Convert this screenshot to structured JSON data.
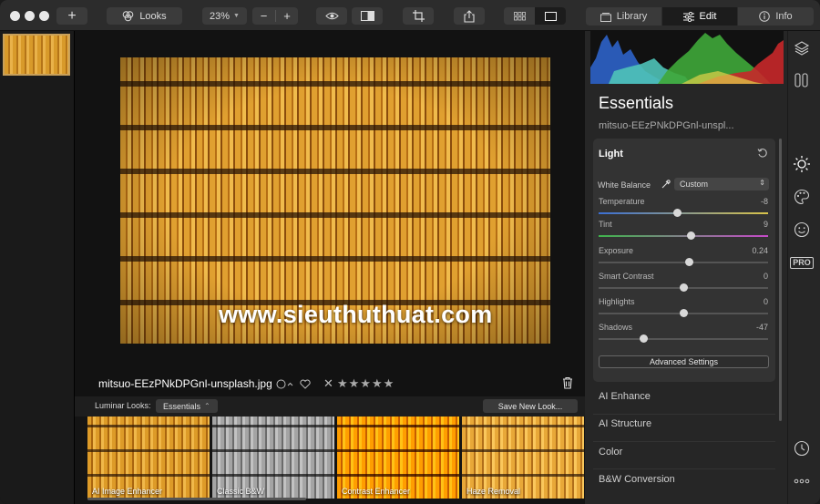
{
  "toolbar": {
    "add_label": "+",
    "looks_label": "Looks",
    "zoom_value": "23%",
    "zoom_out_label": "−",
    "zoom_in_label": "+",
    "tabs": [
      {
        "label": "Library"
      },
      {
        "label": "Edit"
      },
      {
        "label": "Info"
      }
    ]
  },
  "canvas": {
    "watermark": "www.sieuthuthuat.com",
    "file_name": "mitsuo-EEzPNkDPGnl-unsplash.jpg",
    "stars": "★★★★★",
    "reject": "✕"
  },
  "looks_bar": {
    "label": "Luminar Looks:",
    "category": "Essentials",
    "category_arrow": "⌃",
    "save_button": "Save New Look..."
  },
  "looks": [
    {
      "name": "AI Image Enhancer"
    },
    {
      "name": "Classic B&W"
    },
    {
      "name": "Contrast Enhancer"
    },
    {
      "name": "Haze Removal"
    }
  ],
  "panel": {
    "title": "Essentials",
    "file_name": "mitsuo-EEzPNkDPGnl-unspl...",
    "light": {
      "title": "Light",
      "white_balance_label": "White Balance",
      "white_balance_value": "Custom",
      "white_balance_arrow": "⇕",
      "sliders": [
        {
          "label": "Temperature",
          "value": "-8",
          "position": -8,
          "min": -100,
          "max": 100
        },
        {
          "label": "Tint",
          "value": "9",
          "position": 9,
          "min": -100,
          "max": 100
        },
        {
          "label": "Exposure",
          "value": "0.24",
          "position": 0.24,
          "min": -4,
          "max": 4
        },
        {
          "label": "Smart Contrast",
          "value": "0",
          "position": 0,
          "min": -100,
          "max": 100
        },
        {
          "label": "Highlights",
          "value": "0",
          "position": 0,
          "min": -100,
          "max": 100
        },
        {
          "label": "Shadows",
          "value": "-47",
          "position": -47,
          "min": -100,
          "max": 100
        }
      ],
      "advanced_button": "Advanced Settings"
    },
    "sections": [
      {
        "label": "AI Enhance"
      },
      {
        "label": "AI Structure"
      },
      {
        "label": "Color"
      },
      {
        "label": "B&W Conversion"
      }
    ]
  },
  "rail": {
    "pro_label": "PRO"
  },
  "colors": {
    "accent": "#ffffff",
    "panel_bg": "#262626",
    "card_bg": "#333333",
    "histogram_blue": "#2e63c9",
    "histogram_green": "#3fa83a",
    "histogram_red": "#c8282a",
    "histogram_cyan": "#4fc3b8"
  }
}
